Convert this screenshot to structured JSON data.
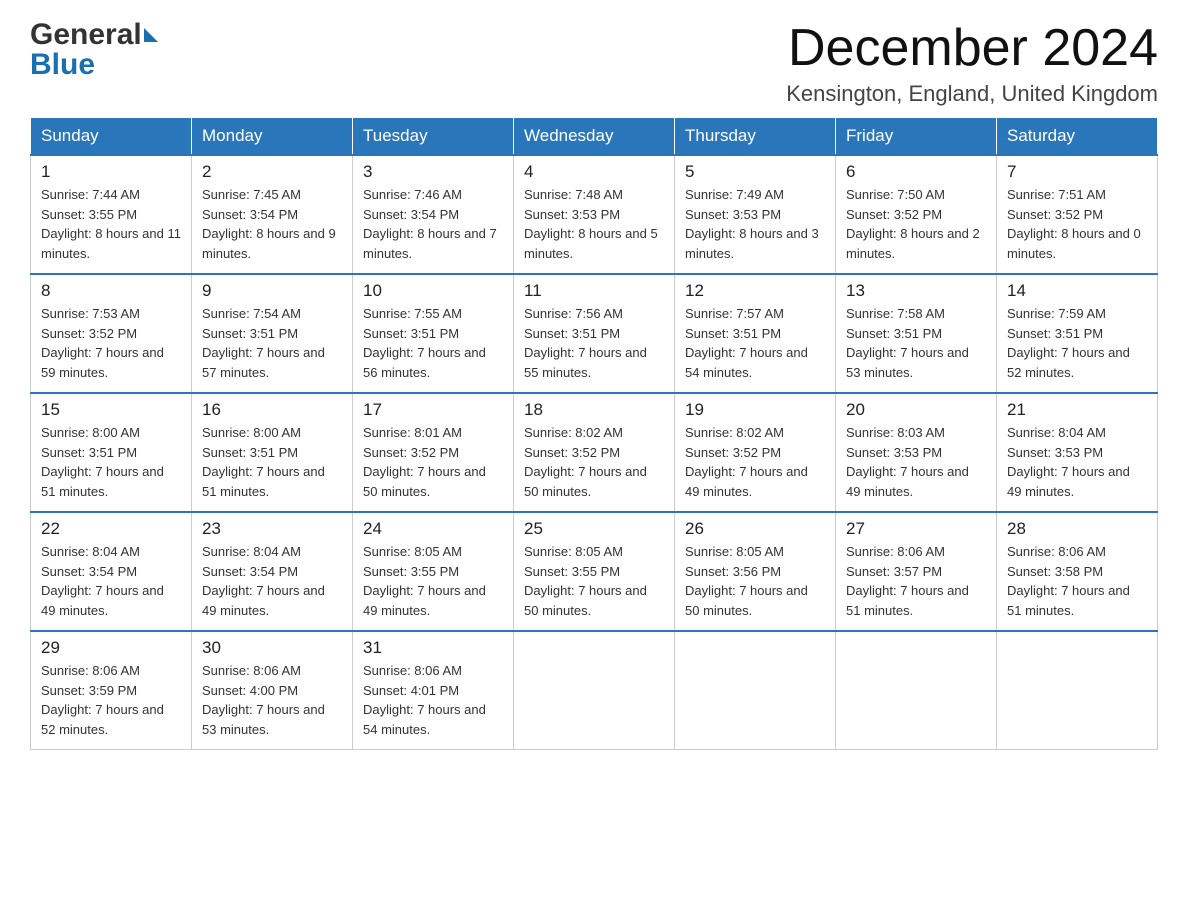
{
  "header": {
    "logo_general": "General",
    "logo_blue": "Blue",
    "month_title": "December 2024",
    "location": "Kensington, England, United Kingdom"
  },
  "weekdays": [
    "Sunday",
    "Monday",
    "Tuesday",
    "Wednesday",
    "Thursday",
    "Friday",
    "Saturday"
  ],
  "weeks": [
    [
      {
        "day": "1",
        "sunrise": "7:44 AM",
        "sunset": "3:55 PM",
        "daylight": "8 hours and 11 minutes."
      },
      {
        "day": "2",
        "sunrise": "7:45 AM",
        "sunset": "3:54 PM",
        "daylight": "8 hours and 9 minutes."
      },
      {
        "day": "3",
        "sunrise": "7:46 AM",
        "sunset": "3:54 PM",
        "daylight": "8 hours and 7 minutes."
      },
      {
        "day": "4",
        "sunrise": "7:48 AM",
        "sunset": "3:53 PM",
        "daylight": "8 hours and 5 minutes."
      },
      {
        "day": "5",
        "sunrise": "7:49 AM",
        "sunset": "3:53 PM",
        "daylight": "8 hours and 3 minutes."
      },
      {
        "day": "6",
        "sunrise": "7:50 AM",
        "sunset": "3:52 PM",
        "daylight": "8 hours and 2 minutes."
      },
      {
        "day": "7",
        "sunrise": "7:51 AM",
        "sunset": "3:52 PM",
        "daylight": "8 hours and 0 minutes."
      }
    ],
    [
      {
        "day": "8",
        "sunrise": "7:53 AM",
        "sunset": "3:52 PM",
        "daylight": "7 hours and 59 minutes."
      },
      {
        "day": "9",
        "sunrise": "7:54 AM",
        "sunset": "3:51 PM",
        "daylight": "7 hours and 57 minutes."
      },
      {
        "day": "10",
        "sunrise": "7:55 AM",
        "sunset": "3:51 PM",
        "daylight": "7 hours and 56 minutes."
      },
      {
        "day": "11",
        "sunrise": "7:56 AM",
        "sunset": "3:51 PM",
        "daylight": "7 hours and 55 minutes."
      },
      {
        "day": "12",
        "sunrise": "7:57 AM",
        "sunset": "3:51 PM",
        "daylight": "7 hours and 54 minutes."
      },
      {
        "day": "13",
        "sunrise": "7:58 AM",
        "sunset": "3:51 PM",
        "daylight": "7 hours and 53 minutes."
      },
      {
        "day": "14",
        "sunrise": "7:59 AM",
        "sunset": "3:51 PM",
        "daylight": "7 hours and 52 minutes."
      }
    ],
    [
      {
        "day": "15",
        "sunrise": "8:00 AM",
        "sunset": "3:51 PM",
        "daylight": "7 hours and 51 minutes."
      },
      {
        "day": "16",
        "sunrise": "8:00 AM",
        "sunset": "3:51 PM",
        "daylight": "7 hours and 51 minutes."
      },
      {
        "day": "17",
        "sunrise": "8:01 AM",
        "sunset": "3:52 PM",
        "daylight": "7 hours and 50 minutes."
      },
      {
        "day": "18",
        "sunrise": "8:02 AM",
        "sunset": "3:52 PM",
        "daylight": "7 hours and 50 minutes."
      },
      {
        "day": "19",
        "sunrise": "8:02 AM",
        "sunset": "3:52 PM",
        "daylight": "7 hours and 49 minutes."
      },
      {
        "day": "20",
        "sunrise": "8:03 AM",
        "sunset": "3:53 PM",
        "daylight": "7 hours and 49 minutes."
      },
      {
        "day": "21",
        "sunrise": "8:04 AM",
        "sunset": "3:53 PM",
        "daylight": "7 hours and 49 minutes."
      }
    ],
    [
      {
        "day": "22",
        "sunrise": "8:04 AM",
        "sunset": "3:54 PM",
        "daylight": "7 hours and 49 minutes."
      },
      {
        "day": "23",
        "sunrise": "8:04 AM",
        "sunset": "3:54 PM",
        "daylight": "7 hours and 49 minutes."
      },
      {
        "day": "24",
        "sunrise": "8:05 AM",
        "sunset": "3:55 PM",
        "daylight": "7 hours and 49 minutes."
      },
      {
        "day": "25",
        "sunrise": "8:05 AM",
        "sunset": "3:55 PM",
        "daylight": "7 hours and 50 minutes."
      },
      {
        "day": "26",
        "sunrise": "8:05 AM",
        "sunset": "3:56 PM",
        "daylight": "7 hours and 50 minutes."
      },
      {
        "day": "27",
        "sunrise": "8:06 AM",
        "sunset": "3:57 PM",
        "daylight": "7 hours and 51 minutes."
      },
      {
        "day": "28",
        "sunrise": "8:06 AM",
        "sunset": "3:58 PM",
        "daylight": "7 hours and 51 minutes."
      }
    ],
    [
      {
        "day": "29",
        "sunrise": "8:06 AM",
        "sunset": "3:59 PM",
        "daylight": "7 hours and 52 minutes."
      },
      {
        "day": "30",
        "sunrise": "8:06 AM",
        "sunset": "4:00 PM",
        "daylight": "7 hours and 53 minutes."
      },
      {
        "day": "31",
        "sunrise": "8:06 AM",
        "sunset": "4:01 PM",
        "daylight": "7 hours and 54 minutes."
      },
      null,
      null,
      null,
      null
    ]
  ]
}
